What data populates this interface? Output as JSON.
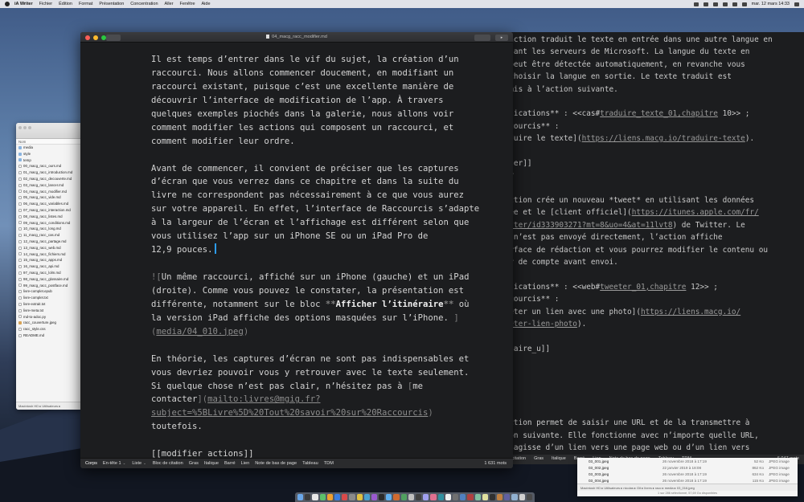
{
  "menubar": {
    "app": "iA Writer",
    "items": [
      "Fichier",
      "Édition",
      "Format",
      "Présentation",
      "Concentration",
      "Aller",
      "Fenêtre",
      "Aide"
    ],
    "clock": "mar. 12 mars 14:33"
  },
  "finder_left": {
    "header": "Nom",
    "items": [
      {
        "label": "media",
        "kind": "folder"
      },
      {
        "label": "style",
        "kind": "folder"
      },
      {
        "label": "temp",
        "kind": "folder"
      },
      {
        "label": "00_macg_racc_ours.md",
        "kind": "doc"
      },
      {
        "label": "01_macg_racc_introduction.md",
        "kind": "doc"
      },
      {
        "label": "02_macg_racc_decouverte.md",
        "kind": "doc"
      },
      {
        "label": "03_macg_racc_lancer.md",
        "kind": "doc"
      },
      {
        "label": "04_macg_racc_modifier.md",
        "kind": "doc"
      },
      {
        "label": "05_macg_racc_vide.md",
        "kind": "doc"
      },
      {
        "label": "06_macg_racc_variables.md",
        "kind": "doc"
      },
      {
        "label": "07_macg_racc_interaction.md",
        "kind": "doc"
      },
      {
        "label": "08_macg_racc_listes.md",
        "kind": "doc"
      },
      {
        "label": "09_macg_racc_conditions.md",
        "kind": "doc"
      },
      {
        "label": "10_macg_racc_long.md",
        "kind": "doc"
      },
      {
        "label": "11_macg_racc_cas.md",
        "kind": "doc"
      },
      {
        "label": "12_macg_racc_partage.md",
        "kind": "doc"
      },
      {
        "label": "13_macg_racc_web.md",
        "kind": "doc"
      },
      {
        "label": "14_macg_racc_fichiers.md",
        "kind": "doc"
      },
      {
        "label": "15_macg_racc_apps.md",
        "kind": "doc"
      },
      {
        "label": "16_macg_racc_api.md",
        "kind": "doc"
      },
      {
        "label": "97_macg_racc_lolm.md",
        "kind": "doc"
      },
      {
        "label": "98_macg_racc_glossaire.md",
        "kind": "doc"
      },
      {
        "label": "99_macg_racc_postface.md",
        "kind": "doc"
      },
      {
        "label": "livre-complet.epub",
        "kind": "doc"
      },
      {
        "label": "livre-complet.txt",
        "kind": "doc"
      },
      {
        "label": "livre-extrait.txt",
        "kind": "doc"
      },
      {
        "label": "livre-meta.txt",
        "kind": "doc"
      },
      {
        "label": "md-to-adoc.py",
        "kind": "doc"
      },
      {
        "label": "racc_couverture.jpeg",
        "kind": "img"
      },
      {
        "label": "racc_style.css",
        "kind": "doc"
      },
      {
        "label": "README.md",
        "kind": "doc"
      }
    ],
    "path": "Macintosh HD ▸ Utilisateurs ▸"
  },
  "main_editor": {
    "title": "04_macg_racc_modifier.md",
    "status": {
      "items": [
        "Corps",
        "En-tête 1",
        "Liste",
        "Bloc de citation",
        "Gras",
        "Italique",
        "Barré",
        "Lien",
        "Note de bas de page",
        "Tableau",
        "TDM"
      ],
      "word_count": "1 631 mots"
    }
  },
  "bg_editor": {
    "status": {
      "items": [
        "ck de citation",
        "Gras",
        "Italique",
        "Barré",
        "Lien",
        "Note de bas de page",
        "Tableau",
        "TDM"
      ],
      "word_count": "6 047 mots"
    }
  },
  "finder_right": {
    "rows": [
      {
        "name": "03_001.jpeg",
        "date": "26 novembre 2018 à 17:19",
        "size": "52 Ko",
        "kind": "JPEG image"
      },
      {
        "name": "03_002.jpeg",
        "date": "22 janvier 2019 à 18:08",
        "size": "862 Ko",
        "kind": "JPEG image"
      },
      {
        "name": "03_003.jpeg",
        "date": "26 novembre 2018 à 17:19",
        "size": "634 Ko",
        "kind": "JPEG image"
      },
      {
        "name": "03_004.jpeg",
        "date": "26 novembre 2018 à 17:19",
        "size": "115 Ko",
        "kind": "JPEG image"
      }
    ],
    "path": "Macintosh HD ▸ Utilisateurs ▸ nicolas ▸ Git ▸ livres ▸ racc ▸ media ▸ 03_016.jpeg",
    "status": "1 sur 286 sélectionné, 57,69 Go disponibles"
  }
}
